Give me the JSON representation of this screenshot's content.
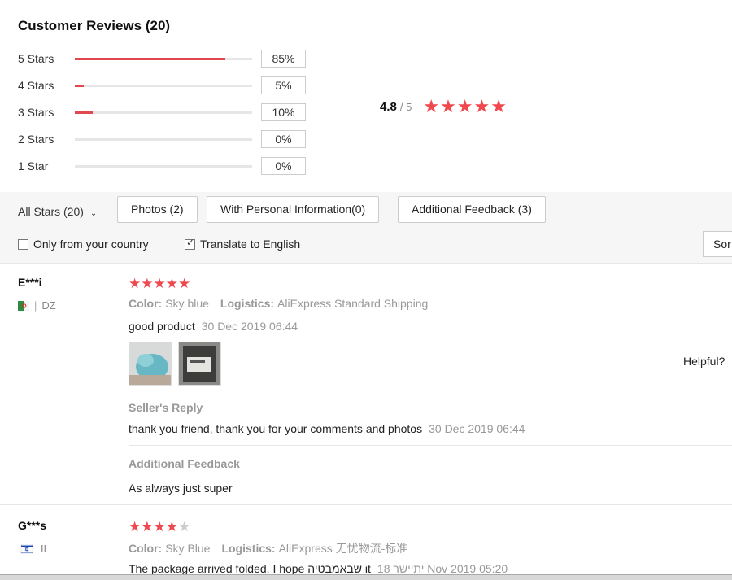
{
  "header": {
    "title": "Customer Reviews (20)"
  },
  "histogram": [
    {
      "label": "5 Stars",
      "percent_text": "85%",
      "fraction": 0.85
    },
    {
      "label": "4 Stars",
      "percent_text": "5%",
      "fraction": 0.05
    },
    {
      "label": "3 Stars",
      "percent_text": "10%",
      "fraction": 0.1
    },
    {
      "label": "2 Stars",
      "percent_text": "0%",
      "fraction": 0.0
    },
    {
      "label": "1 Star",
      "percent_text": "0%",
      "fraction": 0.0
    }
  ],
  "average": {
    "value": "4.8",
    "max": "/ 5",
    "stars": 5
  },
  "filters": {
    "all_stars": "All Stars (20)",
    "photos": "Photos (2)",
    "personal_info": "With Personal Information(0)",
    "additional_feedback": "Additional Feedback (3)",
    "only_country": "Only from your country",
    "translate": "Translate to English",
    "sort": "Sor"
  },
  "colors": {
    "accent": "#f0484f",
    "bar": "#e0484e"
  },
  "reviews": [
    {
      "user": "E***i",
      "country": "DZ",
      "rating": 5,
      "color_label": "Color:",
      "color_value": "Sky blue",
      "logistics_label": "Logistics:",
      "logistics_value": "AliExpress Standard Shipping",
      "text": "good product",
      "date": "30 Dec 2019 06:44",
      "helpful": "Helpful?",
      "seller_reply_title": "Seller's Reply",
      "seller_reply_text": "thank you friend, thank you for your comments and photos",
      "seller_reply_date": "30 Dec 2019 06:44",
      "additional_title": "Additional Feedback",
      "additional_text": "As always just super"
    },
    {
      "user": "G***s",
      "country": "IL",
      "rating": 4,
      "color_label": "Color:",
      "color_value": "Sky Blue",
      "logistics_label": "Logistics:",
      "logistics_value": "AliExpress 无忧物流-标准",
      "text": "The package arrived folded, I hope שבאמבטיה it",
      "date": "18 יתיישר Nov 2019 05:20"
    }
  ]
}
